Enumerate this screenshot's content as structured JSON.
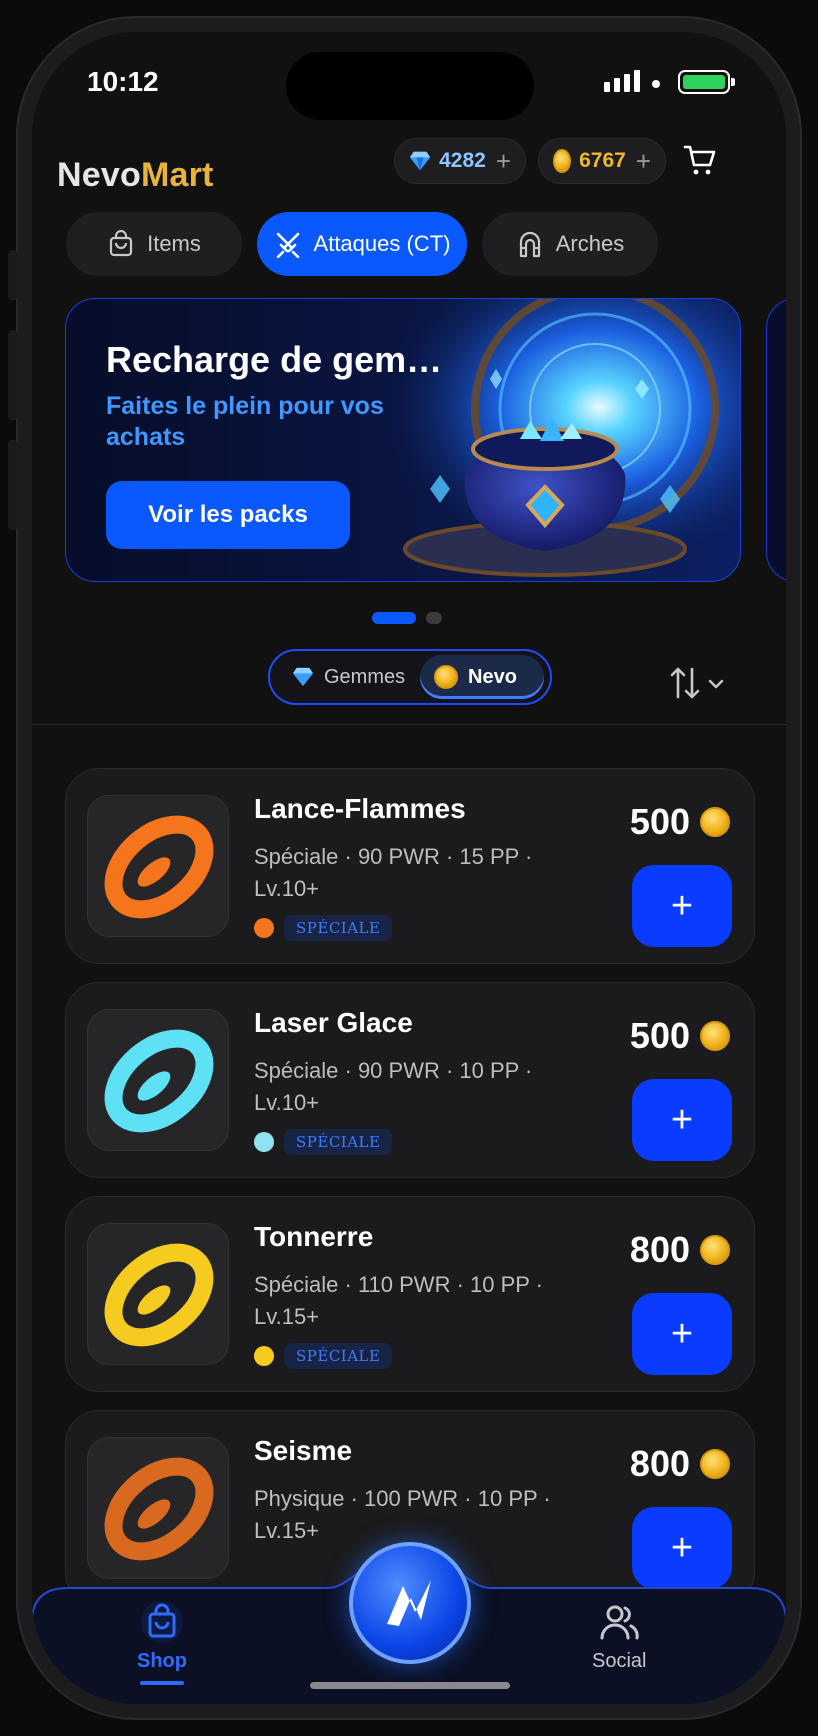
{
  "status_bar": {
    "time": "10:12"
  },
  "header": {
    "logo_part1": "Nevo",
    "logo_part2": "Mart",
    "gems_balance": "4282",
    "coins_balance": "6767",
    "plus_label": "+"
  },
  "tabs": [
    {
      "label": "Items",
      "icon": "bag-icon",
      "active": false
    },
    {
      "label": "Attaques (CT)",
      "icon": "swords-icon",
      "active": true
    },
    {
      "label": "Arches",
      "icon": "arch-icon",
      "active": false
    }
  ],
  "banner": {
    "title": "Recharge de gem…",
    "subtitle": "Faites le plein pour vos achats",
    "button": "Voir les packs",
    "carousel_position": "1 / 2"
  },
  "currency_toggle": {
    "options": [
      "Gemmes",
      "Nevo"
    ],
    "selected": "Nevo"
  },
  "moves": [
    {
      "name": "Lance-Flammes",
      "stats": "Spéciale · 90 PWR · 15 PP · Lv.10+",
      "category": "SPÉCIALE",
      "price": "500",
      "color": "#f4751c",
      "type_icon": "fire-icon"
    },
    {
      "name": "Laser Glace",
      "stats": "Spéciale · 90 PWR · 10 PP · Lv.10+",
      "category": "SPÉCIALE",
      "price": "500",
      "color": "#5ee0f5",
      "type_icon": "snowflake-icon"
    },
    {
      "name": "Tonnerre",
      "stats": "Spéciale · 110 PWR · 10 PP · Lv.15+",
      "category": "SPÉCIALE",
      "price": "800",
      "color": "#f6cb1f",
      "type_icon": "bolt-icon"
    },
    {
      "name": "Seisme",
      "stats": "Physique · 100 PWR · 10 PP · Lv.15+",
      "category": "PHYSIQUE",
      "price": "800",
      "color": "#d9691e",
      "type_icon": "ground-icon"
    }
  ],
  "add_label": "+",
  "bottom_nav": {
    "shop": "Shop",
    "social": "Social"
  },
  "colors": {
    "accent": "#0a59ff",
    "gold": "#e8b43a",
    "background": "#111112"
  }
}
